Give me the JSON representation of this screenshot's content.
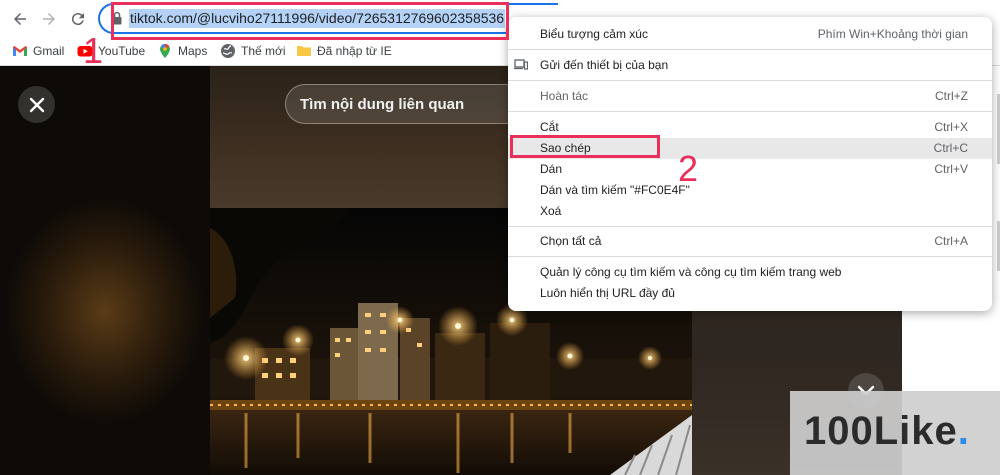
{
  "browser": {
    "url": "tiktok.com/@lucviho27111996/video/7265312769602358536",
    "bookmarks": [
      {
        "label": "Gmail",
        "icon": "gmail-icon"
      },
      {
        "label": "YouTube",
        "icon": "youtube-icon"
      },
      {
        "label": "Maps",
        "icon": "maps-icon"
      },
      {
        "label": "Thế mới",
        "icon": "globe-icon"
      },
      {
        "label": "Đã nhập từ IE",
        "icon": "folder-icon"
      }
    ],
    "colors": {
      "focus_ring": "#1a73e8",
      "selection": "#b4d2f6"
    }
  },
  "page": {
    "search_label": "Tìm nội dung liên quan"
  },
  "context_menu": {
    "items": [
      {
        "label": "Biểu tượng cảm xúc",
        "shortcut": "Phím Win+Khoảng thời gian"
      },
      {
        "label": "Gửi đến thiết bị của bạn",
        "shortcut": "",
        "icon": "devices-icon"
      },
      {
        "label": "Hoàn tác",
        "shortcut": "Ctrl+Z",
        "disabled": true
      },
      {
        "label": "Cắt",
        "shortcut": "Ctrl+X"
      },
      {
        "label": "Sao chép",
        "shortcut": "Ctrl+C",
        "highlighted": true
      },
      {
        "label": "Dán",
        "shortcut": "Ctrl+V"
      },
      {
        "label": "Dán và tìm kiếm \"#FC0E4F\"",
        "shortcut": ""
      },
      {
        "label": "Xoá",
        "shortcut": ""
      },
      {
        "label": "Chọn tất cả",
        "shortcut": "Ctrl+A"
      },
      {
        "label": "Quản lý công cụ tìm kiếm và công cụ tìm kiếm trang web",
        "shortcut": ""
      },
      {
        "label": "Luôn hiển thị URL đầy đủ",
        "shortcut": ""
      }
    ]
  },
  "annotations": {
    "step1": "1",
    "step2": "2",
    "color": "#e8305a"
  },
  "watermark": {
    "text": "100Like",
    "dot": "."
  }
}
